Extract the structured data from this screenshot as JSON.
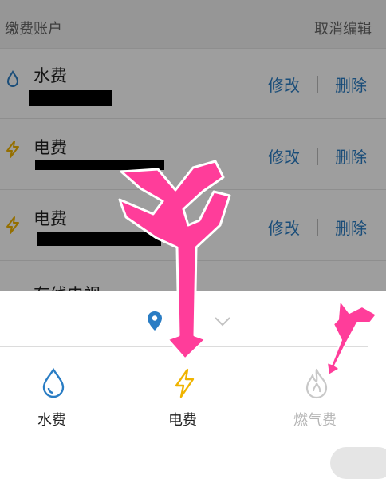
{
  "header": {
    "title": "缴费账户",
    "cancel_label": "取消编辑"
  },
  "accounts": [
    {
      "name": "水费",
      "edit_label": "修改",
      "delete_label": "删除",
      "icon": "water-drop-icon"
    },
    {
      "name": "电费",
      "edit_label": "修改",
      "delete_label": "删除",
      "icon": "lightning-icon"
    },
    {
      "name": "电费",
      "edit_label": "修改",
      "delete_label": "删除",
      "icon": "lightning-icon"
    }
  ],
  "partial_row": {
    "name": "有线电视"
  },
  "sheet": {
    "location_icon": "location-pin-icon",
    "dropdown_icon": "chevron-down-icon",
    "categories": [
      {
        "label": "水费",
        "icon": "water-drop-icon",
        "color": "#2a7dc4"
      },
      {
        "label": "电费",
        "icon": "lightning-icon",
        "color": "#f0b400"
      },
      {
        "label": "燃气费",
        "icon": "flame-icon",
        "color": "#c8c8c8"
      }
    ]
  },
  "colors": {
    "accent_blue": "#2a7dc4",
    "arrow_pink": "#ff3d9a",
    "lightning_yellow": "#f0b400"
  }
}
